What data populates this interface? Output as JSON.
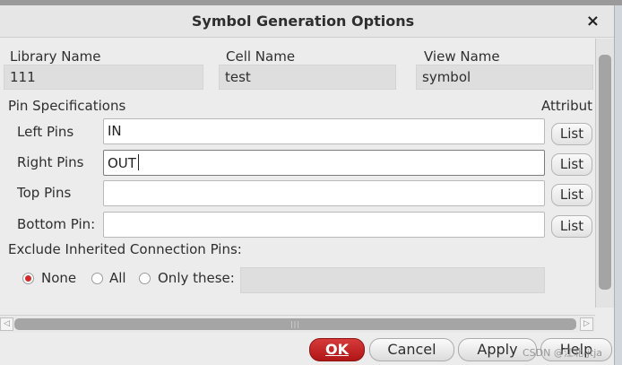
{
  "window": {
    "title": "Symbol Generation Options",
    "close_glyph": "×"
  },
  "header_fields": {
    "library_label": "Library Name",
    "library_value": "111",
    "cell_label": "Cell Name",
    "cell_value": "test",
    "view_label": "View Name",
    "view_value": "symbol"
  },
  "pin_specs": {
    "section_label": "Pin Specifications",
    "attr_label": "Attribut",
    "rows": [
      {
        "label": "Left Pins",
        "value": "IN",
        "button": "List"
      },
      {
        "label": "Right Pins",
        "value": "OUT",
        "button": "List"
      },
      {
        "label": "Top Pins",
        "value": "",
        "button": "List"
      },
      {
        "label": "Bottom Pin:",
        "value": "",
        "button": "List"
      }
    ]
  },
  "exclude": {
    "label": "Exclude Inherited Connection Pins:",
    "options": [
      {
        "label": "None",
        "selected": true
      },
      {
        "label": "All",
        "selected": false
      },
      {
        "label": "Only these:",
        "selected": false
      }
    ],
    "only_these_value": ""
  },
  "scrollbar": {
    "left_arrow": "◁",
    "right_arrow": "▷",
    "grip": "|||"
  },
  "buttons": {
    "ok": "OK",
    "cancel": "Cancel",
    "apply": "Apply",
    "help": "Help"
  },
  "watermark": "CSDN @江北-jtja",
  "colors": {
    "ok_button": "#c21f1f",
    "radio_selected": "#d02a2a",
    "background": "#ececec"
  }
}
